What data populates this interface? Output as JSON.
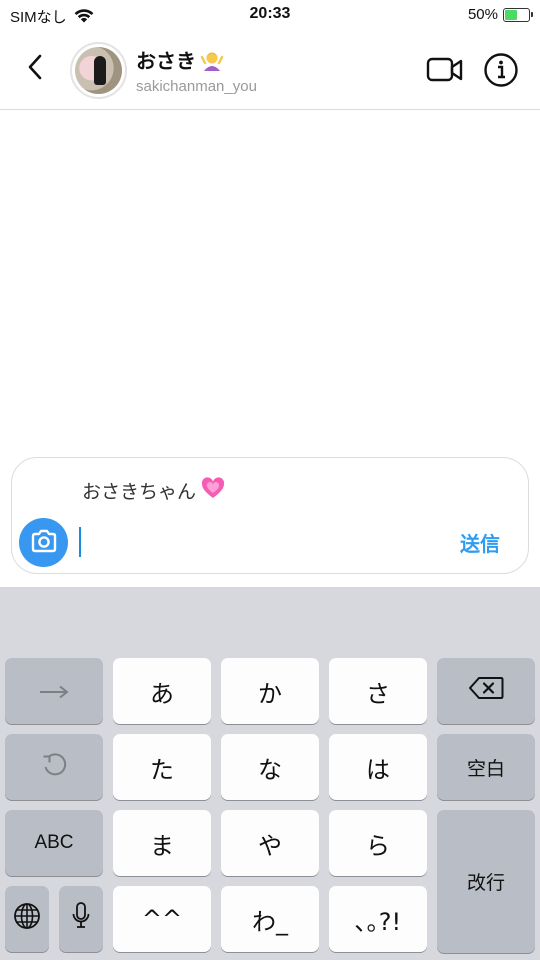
{
  "status_bar": {
    "carrier": "SIMなし",
    "time": "20:33",
    "battery": "50%",
    "battery_level": 0.5
  },
  "header": {
    "name": "おさき",
    "username": "sakichanman_you"
  },
  "composer": {
    "reply_text": "おさきちゃん",
    "input_value": "",
    "send_label": "送信"
  },
  "keyboard": {
    "row1": [
      "あ",
      "か",
      "さ"
    ],
    "row2": [
      "た",
      "な",
      "は"
    ],
    "row3": [
      "ま",
      "や",
      "ら"
    ],
    "row4": [
      "^^",
      "わ_",
      "､｡?!"
    ],
    "abc_label": "ABC",
    "space_label": "空白",
    "return_label": "改行"
  }
}
